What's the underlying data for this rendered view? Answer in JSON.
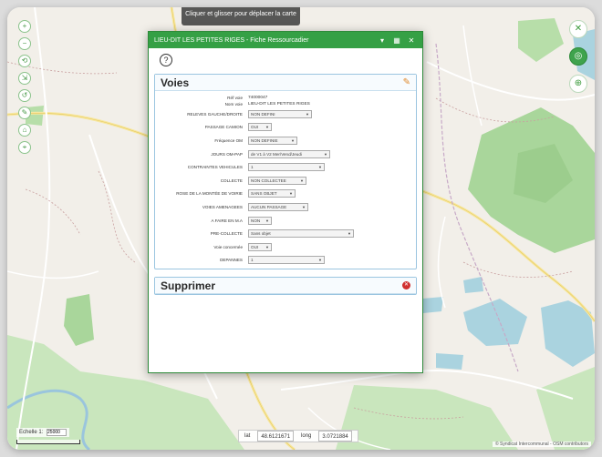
{
  "map": {
    "hint": "Cliquer et glisser pour déplacer la carte",
    "left_controls": [
      "+",
      "−",
      "⟲",
      "⇲",
      "↺",
      "✎",
      "⌂",
      "⌖"
    ],
    "right_controls": [
      {
        "name": "layers-icon",
        "glyph": "✕",
        "active": false
      },
      {
        "name": "locate-icon",
        "glyph": "◎",
        "active": true
      },
      {
        "name": "search-icon",
        "glyph": "⊕",
        "active": false
      }
    ],
    "scale_label": "Echelle 1:",
    "scale_value": "25000",
    "coord_lat_label": "lat",
    "coord_lat": "48.6121671",
    "coord_lng_label": "long",
    "coord_lng": "3.0721884",
    "attribution": "© Syndicat Intercommunal - OSM contributors",
    "colors": {
      "background": "#f2efe9",
      "forest": "#a9d69b",
      "forest_dark": "#8cc77a",
      "water": "#aad3df",
      "road_major": "#f7e7a0",
      "road_minor": "#ffffff",
      "river": "#9ac5dd"
    }
  },
  "panel": {
    "title": "LIEU-DIT LES PETITES RIGES - Fiche Ressourcadier",
    "header_icons": {
      "minimize": "▾",
      "print": "▦",
      "close": "✕"
    },
    "help_glyph": "?",
    "voies": {
      "title": "Voies",
      "ref_label": "Réf voie",
      "ref_value": "74000047",
      "nom_label": "Nom voie",
      "nom_value": "LIEU-DIT LES PETITES RIGES",
      "fields": [
        {
          "label": "RELEVES GAUCHE/DROITE",
          "value": "NON DEFINI",
          "width": 70
        },
        {
          "label": "PASSAGE CAMION",
          "value": "OUI",
          "width": 26
        },
        {
          "label": "Fréquence OM",
          "value": "NON DEFINIE",
          "width": 54
        },
        {
          "label": "JOURS OM-PAP",
          "value": "de V1 à V2 Mer/Vend/Jeudi",
          "width": 90
        },
        {
          "label": "CONTRAINTES VEHICULES",
          "value": "1",
          "width": 84
        },
        {
          "label": "COLLECTE",
          "value": "NON COLLECTEE",
          "width": 64
        },
        {
          "label": "ROSE DE LA MONTÉE DE VOIRIE",
          "value": "SANS OBJET",
          "width": 52
        },
        {
          "label": "VOIES AMENAGEES",
          "value": "AUCUN PASSAGE",
          "width": 66
        },
        {
          "label": "A FAIRE EN M.A",
          "value": "NON",
          "width": 26
        },
        {
          "label": "PRE-COLLECTE",
          "value": "Sans objet",
          "width": 116
        },
        {
          "label": "Voie concernée",
          "value": "OUI",
          "width": 26
        },
        {
          "label": "DEPANNES",
          "value": "1",
          "width": 84
        }
      ]
    },
    "supprimer": {
      "title": "Supprimer",
      "icon_glyph": "✕"
    }
  }
}
